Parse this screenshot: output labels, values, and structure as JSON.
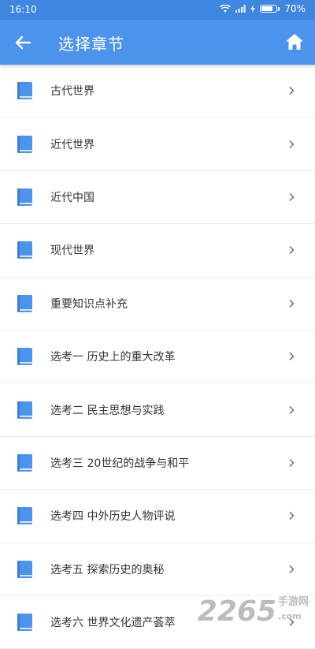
{
  "status_bar": {
    "time": "16:10",
    "battery": "70%"
  },
  "app_bar": {
    "title": "选择章节"
  },
  "chapters": [
    {
      "label": "古代世界"
    },
    {
      "label": "近代世界"
    },
    {
      "label": "近代中国"
    },
    {
      "label": "现代世界"
    },
    {
      "label": "重要知识点补充"
    },
    {
      "label": "选考一 历史上的重大改革"
    },
    {
      "label": "选考二 民主思想与实践"
    },
    {
      "label": "选考三 20世纪的战争与和平"
    },
    {
      "label": "选考四 中外历史人物评说"
    },
    {
      "label": "选考五 探索历史的奥秘"
    },
    {
      "label": "选考六 世界文化遗产荟萃"
    }
  ],
  "watermark": {
    "number": "2265",
    "suffix": ".com",
    "brand": "手游网"
  },
  "colors": {
    "status_bar": "#3e86e0",
    "app_bar": "#4c93ee",
    "book_icon": "#4c93ee"
  },
  "icons": [
    "back-arrow-icon",
    "home-icon",
    "book-icon",
    "chevron-right-icon",
    "wifi-icon",
    "signal-icon",
    "battery-icon"
  ]
}
